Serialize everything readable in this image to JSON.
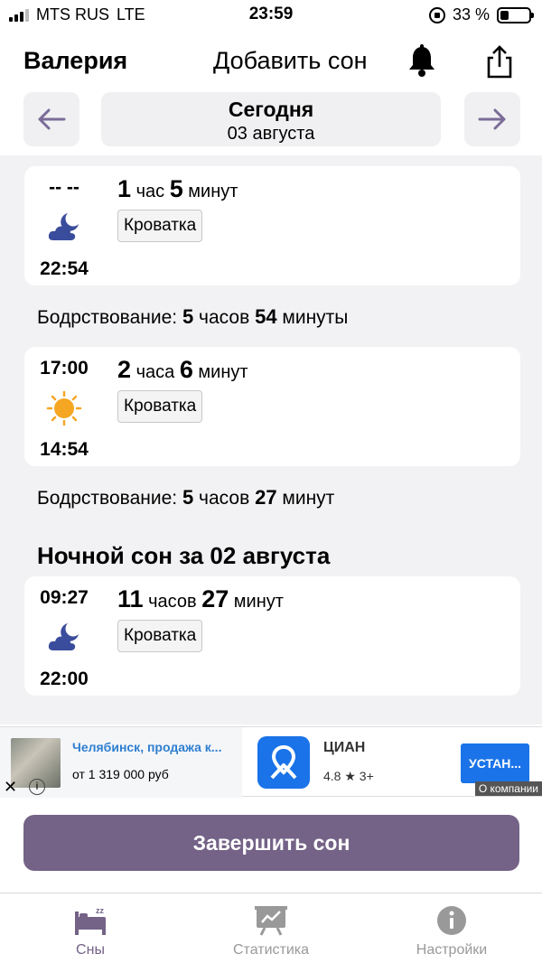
{
  "status_bar": {
    "carrier": "MTS RUS",
    "network": "LTE",
    "time": "23:59",
    "battery": "33 %"
  },
  "header": {
    "user_name": "Валерия",
    "add_sleep": "Добавить сон"
  },
  "date_nav": {
    "title": "Сегодня",
    "date": "03 августа"
  },
  "sleeps": [
    {
      "end": "-- --",
      "start": "22:54",
      "icon": "moon-cloud-icon",
      "dur_a_num": "1",
      "dur_a_unit": "час",
      "dur_b_num": "5",
      "dur_b_unit": "минут",
      "place": "Кроватка"
    },
    {
      "end": "17:00",
      "start": "14:54",
      "icon": "sun-icon",
      "dur_a_num": "2",
      "dur_a_unit": "часа",
      "dur_b_num": "6",
      "dur_b_unit": "минут",
      "place": "Кроватка"
    },
    {
      "end": "09:27",
      "start": "22:00",
      "icon": "moon-cloud-icon",
      "dur_a_num": "11",
      "dur_a_unit": "часов",
      "dur_b_num": "27",
      "dur_b_unit": "минут",
      "place": "Кроватка"
    }
  ],
  "wake_periods": [
    {
      "label": "Бодрствование:",
      "h_num": "5",
      "h_unit": "часов",
      "m_num": "54",
      "m_unit": "минуты"
    },
    {
      "label": "Бодрствование:",
      "h_num": "5",
      "h_unit": "часов",
      "m_num": "27",
      "m_unit": "минут"
    }
  ],
  "night_title": "Ночной сон за 02 августа",
  "ad": {
    "title": "Челябинск, продажа к...",
    "price": "от 1 319 000 руб",
    "app_name": "ЦИАН",
    "rating": "4.8 ★ 3+",
    "install": "УСТАН...",
    "company": "О компании"
  },
  "finish_button": "Завершить сон",
  "tabs": [
    {
      "label": "Сны",
      "icon": "bed-icon"
    },
    {
      "label": "Статистика",
      "icon": "chart-board-icon"
    },
    {
      "label": "Настройки",
      "icon": "info-icon"
    }
  ],
  "colors": {
    "accent": "#746287",
    "nav_arrow": "#7a6b98",
    "moon": "#3a4c9c",
    "sun": "#f5a623",
    "ad_blue": "#1a73e8"
  }
}
